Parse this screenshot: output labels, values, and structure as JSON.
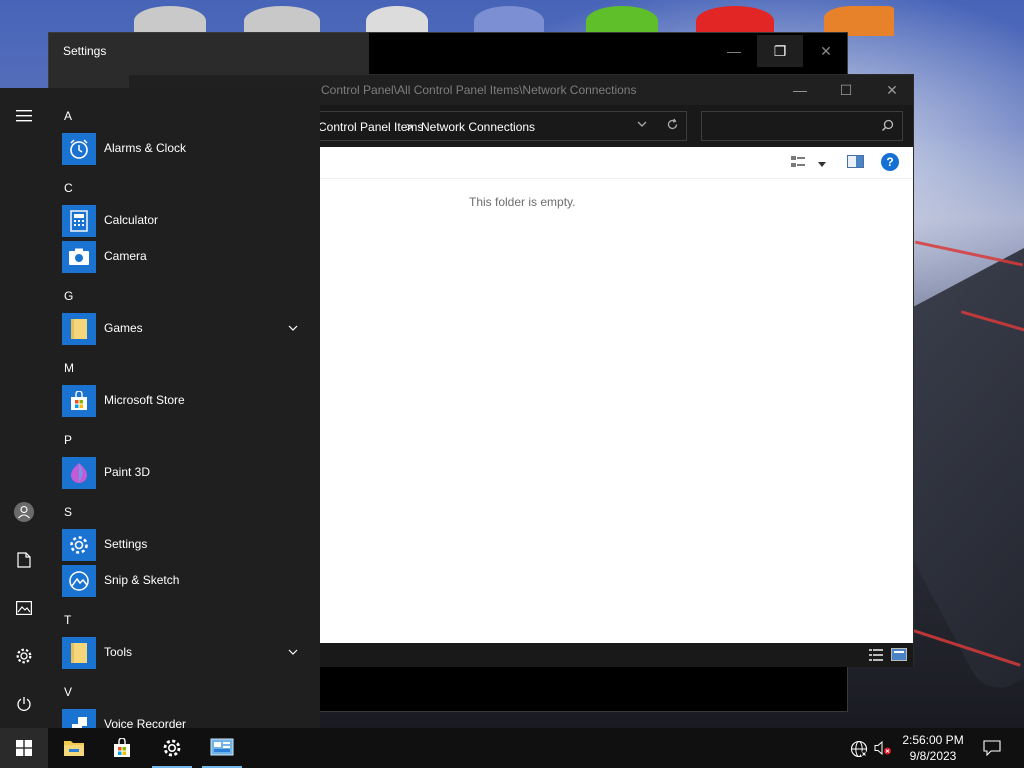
{
  "settings_window": {
    "title": "Settings",
    "controls": {
      "minimize": "—",
      "restore": "❐",
      "close": "✕"
    }
  },
  "explorer": {
    "title": "Control Panel\\All Control Panel Items\\Network Connections",
    "breadcrumb": [
      "Control Panel Items",
      "Network Connections"
    ],
    "breadcrumb_sep": ">",
    "search_placeholder": "",
    "empty_message": "This folder is empty.",
    "help_label": "?",
    "controls": {
      "minimize": "—",
      "maximize": "☐",
      "close": "✕"
    }
  },
  "start_menu": {
    "groups": [
      {
        "letter": "A",
        "apps": [
          {
            "label": "Alarms & Clock",
            "icon": "alarm-clock-icon"
          }
        ]
      },
      {
        "letter": "C",
        "apps": [
          {
            "label": "Calculator",
            "icon": "calculator-icon"
          },
          {
            "label": "Camera",
            "icon": "camera-icon"
          }
        ]
      },
      {
        "letter": "G",
        "apps": [
          {
            "label": "Games",
            "icon": "folder-icon",
            "expandable": true
          }
        ]
      },
      {
        "letter": "M",
        "apps": [
          {
            "label": "Microsoft Store",
            "icon": "store-icon"
          }
        ]
      },
      {
        "letter": "P",
        "apps": [
          {
            "label": "Paint 3D",
            "icon": "paint3d-icon"
          }
        ]
      },
      {
        "letter": "S",
        "apps": [
          {
            "label": "Settings",
            "icon": "gear-icon"
          },
          {
            "label": "Snip & Sketch",
            "icon": "snip-icon"
          }
        ]
      },
      {
        "letter": "T",
        "apps": [
          {
            "label": "Tools",
            "icon": "folder-icon",
            "expandable": true
          }
        ]
      },
      {
        "letter": "V",
        "apps": [
          {
            "label": "Voice Recorder",
            "icon": "microphone-icon"
          }
        ]
      }
    ],
    "rail": [
      "hamburger-icon",
      "user-icon",
      "documents-icon",
      "pictures-icon",
      "settings-icon",
      "power-icon"
    ]
  },
  "taskbar": {
    "items": [
      "windows-start-icon",
      "file-explorer-icon",
      "microsoft-store-icon",
      "settings-icon",
      "control-panel-icon"
    ],
    "clock": {
      "time": "2:56:00 PM",
      "date": "9/8/2023"
    },
    "tray": [
      "network-icon",
      "volume-muted-icon",
      "notification-icon"
    ]
  },
  "colors": {
    "accent": "#1a73d0",
    "start_bg": "#1f1f1f",
    "taskbar_bg": "#101010",
    "explorer_chrome": "#191919"
  }
}
